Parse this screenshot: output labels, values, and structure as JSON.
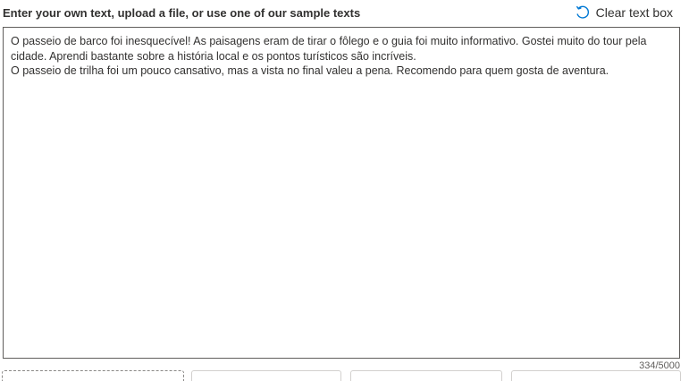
{
  "header": {
    "label": "Enter your own text, upload a file, or use one of our sample texts",
    "clear_label": "Clear text box",
    "clear_icon": "undo-icon"
  },
  "text_box": {
    "value": "O passeio de barco foi inesquecível! As paisagens eram de tirar o fôlego e o guia foi muito informativo. Gostei muito do tour pela cidade. Aprendi bastante sobre a história local e os pontos turísticos são incríveis.\nO passeio de trilha foi um pouco cansativo, mas a vista no final valeu a pena. Recomendo para quem gosta de aventura."
  },
  "char_count": "334/5000",
  "colors": {
    "text": "#323130",
    "border": "#605e5c",
    "accent": "#0078d4"
  }
}
